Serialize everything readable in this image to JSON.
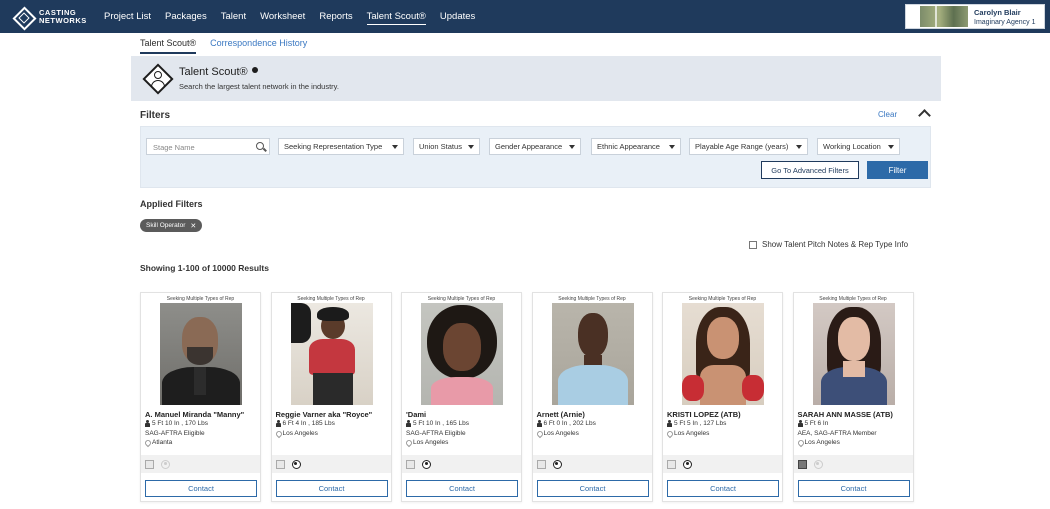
{
  "topnav": {
    "logo_line1": "CASTING",
    "logo_line2": "NETWORKS",
    "items": [
      "Project List",
      "Packages",
      "Talent",
      "Worksheet",
      "Reports",
      "Talent Scout®",
      "Updates"
    ],
    "active_item": "Talent Scout®",
    "account": {
      "name": "Carolyn Blair",
      "agency": "Imaginary Agency 1"
    }
  },
  "subtabs": [
    "Talent Scout®",
    "Correspondence History"
  ],
  "hero": {
    "title": "Talent Scout®",
    "subtitle": "Search the largest talent network in the industry."
  },
  "filters": {
    "title": "Filters",
    "clear_label": "Clear",
    "search_placeholder": "Stage Name",
    "dropdowns": [
      "Seeking Representation Type",
      "Union Status",
      "Gender Appearance",
      "Ethnic Appearance",
      "Playable Age Range (years)",
      "Working Location"
    ],
    "advanced_label": "Go To Advanced Filters",
    "filter_label": "Filter"
  },
  "applied": {
    "title": "Applied Filters",
    "chips": [
      "Skill Operator"
    ]
  },
  "pitch_notes_label": "Show Talent Pitch Notes & Rep Type Info",
  "results_label": "Showing 1-100 of 10000 Results",
  "cards": [
    {
      "tag": "Seeking Multiple Types of Rep",
      "name": "A. Manuel Miranda \"Manny\"",
      "stats": "5 Ft 10 In , 170 Lbs",
      "union": "SAG-AFTRA Eligible",
      "location": "Atlanta",
      "resume_dark": false,
      "reel_dark": false,
      "contact": "Contact"
    },
    {
      "tag": "Seeking Multiple Types of Rep",
      "name": "Reggie Varner aka \"Royce\"",
      "stats": "6 Ft 4 In , 185 Lbs",
      "union": "",
      "location": "Los Angeles",
      "resume_dark": false,
      "reel_dark": true,
      "contact": "Contact"
    },
    {
      "tag": "Seeking Multiple Types of Rep",
      "name": "'Dami",
      "stats": "5 Ft 10 In , 165 Lbs",
      "union": "SAG-AFTRA Eligible",
      "location": "Los Angeles",
      "resume_dark": false,
      "reel_dark": true,
      "contact": "Contact"
    },
    {
      "tag": "Seeking Multiple Types of Rep",
      "name": "Arnett (Arnie)",
      "stats": "6 Ft 0 In , 202 Lbs",
      "union": "",
      "location": "Los Angeles",
      "resume_dark": false,
      "reel_dark": true,
      "contact": "Contact"
    },
    {
      "tag": "Seeking Multiple Types of Rep",
      "name": "KRISTI LOPEZ (ATB)",
      "stats": "5 Ft 5 In , 127 Lbs",
      "union": "",
      "location": "Los Angeles",
      "resume_dark": false,
      "reel_dark": true,
      "contact": "Contact"
    },
    {
      "tag": "Seeking Multiple Types of Rep",
      "name": "SARAH ANN MASSE (ATB)",
      "stats": "5 Ft 6 In",
      "union": "AEA, SAG-AFTRA Member",
      "location": "Los Angeles",
      "resume_dark": true,
      "reel_dark": false,
      "contact": "Contact"
    }
  ]
}
